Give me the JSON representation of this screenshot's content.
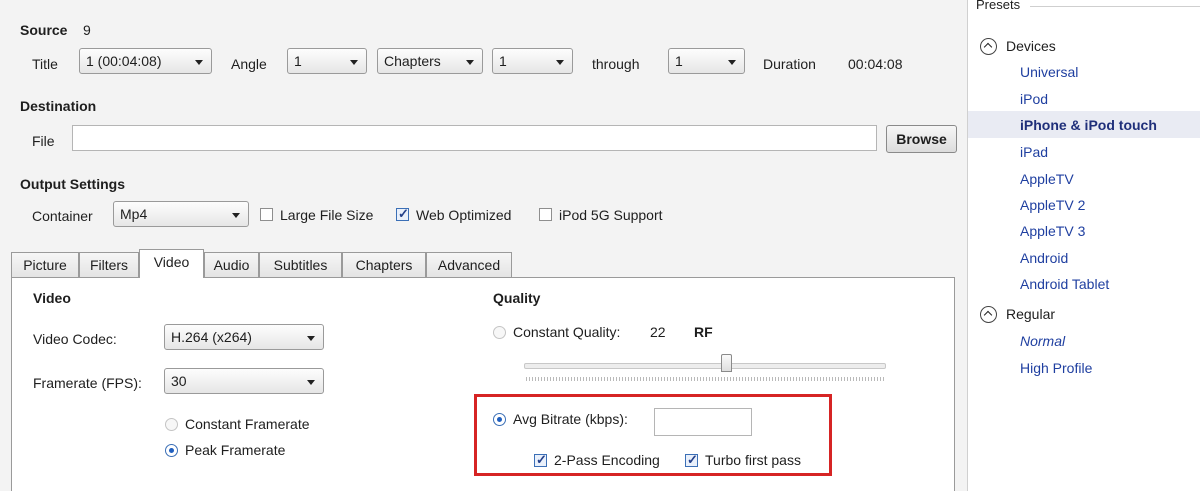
{
  "source": {
    "label": "Source",
    "value": "9"
  },
  "title_row": {
    "title_label": "Title",
    "title_value": "1 (00:04:08)",
    "angle_label": "Angle",
    "angle_value": "1",
    "chapters_mode": "Chapters",
    "chapter_start": "1",
    "through_label": "through",
    "chapter_end": "1",
    "duration_label": "Duration",
    "duration_value": "00:04:08"
  },
  "destination": {
    "heading": "Destination",
    "file_label": "File",
    "file_value": "",
    "browse_label": "Browse"
  },
  "output_settings": {
    "heading": "Output Settings",
    "container_label": "Container",
    "container_value": "Mp4",
    "large_file_label": "Large File Size",
    "large_file_checked": false,
    "web_optimized_label": "Web Optimized",
    "web_optimized_checked": true,
    "ipod_label": "iPod 5G Support",
    "ipod_checked": false
  },
  "tabs": [
    "Picture",
    "Filters",
    "Video",
    "Audio",
    "Subtitles",
    "Chapters",
    "Advanced"
  ],
  "active_tab": "Video",
  "video": {
    "heading": "Video",
    "codec_label": "Video Codec:",
    "codec_value": "H.264 (x264)",
    "framerate_label": "Framerate (FPS):",
    "framerate_value": "30",
    "constant_framerate_label": "Constant Framerate",
    "peak_framerate_label": "Peak Framerate",
    "framerate_mode": "Peak Framerate"
  },
  "quality": {
    "heading": "Quality",
    "constant_quality_label": "Constant Quality:",
    "constant_quality_value": "22",
    "rf_label": "RF",
    "avg_bitrate_label": "Avg Bitrate (kbps):",
    "avg_bitrate_value": "",
    "mode": "Avg Bitrate (kbps)",
    "two_pass_label": "2-Pass Encoding",
    "two_pass_checked": true,
    "turbo_label": "Turbo first pass",
    "turbo_checked": true,
    "highlight_color": "#d62424"
  },
  "presets": {
    "heading": "Presets",
    "groups": [
      {
        "name": "Devices",
        "items": [
          "Universal",
          "iPod",
          "iPhone & iPod touch",
          "iPad",
          "AppleTV",
          "AppleTV 2",
          "AppleTV 3",
          "Android",
          "Android Tablet"
        ]
      },
      {
        "name": "Regular",
        "items": [
          "Normal",
          "High Profile"
        ]
      }
    ],
    "selected": "iPhone & iPod touch",
    "default": "Normal",
    "link_color": "#1f3fa0",
    "selected_bg": "#e9ebf3"
  }
}
